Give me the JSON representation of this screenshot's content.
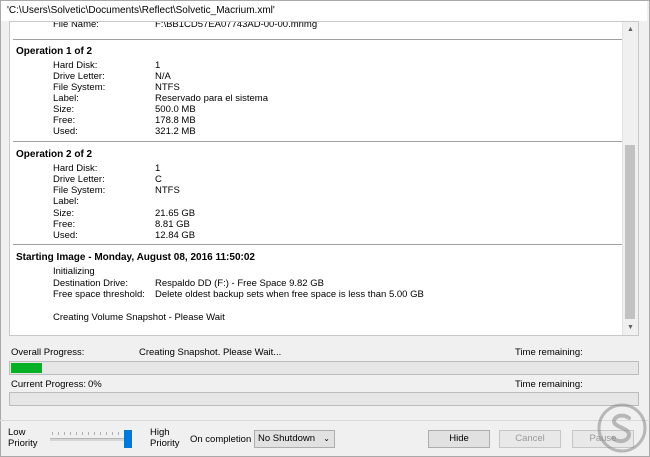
{
  "window": {
    "title": "'C:\\Users\\Solvetic\\Documents\\Reflect\\Solvetic_Macrium.xml'"
  },
  "log": {
    "partial_line": {
      "label": "File Name:",
      "value": "F:\\BB1CD57EA07743AD-00-00.mrimg"
    },
    "operation1": {
      "title": "Operation 1 of 2",
      "rows": [
        {
          "label": "Hard Disk:",
          "value": "1"
        },
        {
          "label": "Drive Letter:",
          "value": "N/A"
        },
        {
          "label": "File System:",
          "value": "NTFS"
        },
        {
          "label": "Label:",
          "value": "Reservado para el sistema"
        },
        {
          "label": "Size:",
          "value": "500.0 MB"
        },
        {
          "label": "Free:",
          "value": "178.8 MB"
        },
        {
          "label": "Used:",
          "value": "321.2 MB"
        }
      ]
    },
    "operation2": {
      "title": "Operation 2 of 2",
      "rows": [
        {
          "label": "Hard Disk:",
          "value": "1"
        },
        {
          "label": "Drive Letter:",
          "value": "C"
        },
        {
          "label": "File System:",
          "value": "NTFS"
        },
        {
          "label": "Label:",
          "value": ""
        },
        {
          "label": "Size:",
          "value": "21.65 GB"
        },
        {
          "label": "Free:",
          "value": "8.81 GB"
        },
        {
          "label": "Used:",
          "value": "12.84 GB"
        }
      ]
    },
    "starting": {
      "title": "Starting Image - Monday, August 08, 2016 11:50:02",
      "initializing": "Initializing",
      "rows": [
        {
          "label": "Destination Drive:",
          "value": "Respaldo DD (F:) - Free Space 9.82 GB"
        },
        {
          "label": "Free space threshold:",
          "value": "Delete oldest backup sets when free space is less than 5.00 GB"
        }
      ],
      "status": "Creating Volume Snapshot - Please Wait"
    }
  },
  "scrollbar": {
    "up_icon": "chevron-up-icon",
    "down_icon": "chevron-down-icon"
  },
  "progress": {
    "overall_label": "Overall Progress:",
    "overall_status": "Creating Snapshot. Please Wait...",
    "time_remaining_label": "Time remaining:",
    "overall_fraction": 0.05,
    "current_label": "Current Progress:",
    "current_percent": "0%",
    "current_time_remaining_label": "Time remaining:",
    "current_fraction": 0.0,
    "fill_color": "#06b025"
  },
  "footer": {
    "low_priority_line1": "Low",
    "low_priority_line2": "Priority",
    "high_priority_line1": "High",
    "high_priority_line2": "Priority",
    "priority_level": 1.0,
    "on_completion_label": "On completion",
    "on_completion_value": "No Shutdown",
    "hide_label": "Hide",
    "cancel_label": "Cancel",
    "pause_label": "Pause",
    "accent_color": "#0078d7"
  }
}
